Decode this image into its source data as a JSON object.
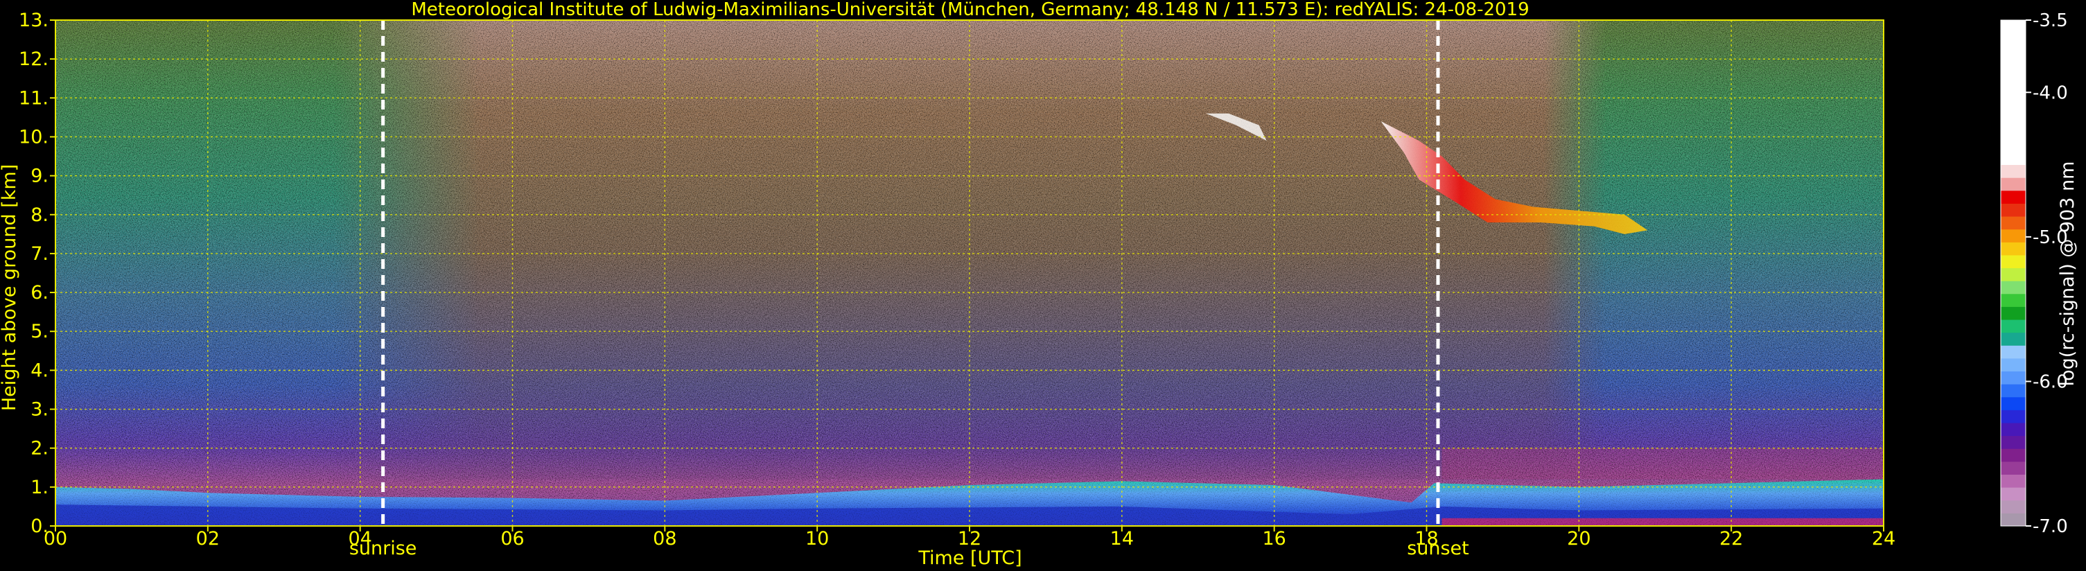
{
  "chart_data": {
    "type": "heatmap",
    "title": "Meteorological Institute of Ludwig-Maximilians-Universität (München, Germany; 48.148 N / 11.573 E):    redYALIS: 24-08-2019",
    "xlabel": "Time [UTC]",
    "ylabel": "Height above ground [km]",
    "xlim": [
      0,
      24
    ],
    "ylim": [
      0,
      13
    ],
    "x_ticks": [
      0,
      2,
      4,
      6,
      8,
      10,
      12,
      14,
      16,
      18,
      20,
      22,
      24
    ],
    "x_tick_labels": [
      "00",
      "02",
      "04",
      "06",
      "08",
      "10",
      "12",
      "14",
      "16",
      "18",
      "20",
      "22",
      "24"
    ],
    "y_ticks": [
      0,
      1,
      2,
      3,
      4,
      5,
      6,
      7,
      8,
      9,
      10,
      11,
      12,
      13
    ],
    "y_tick_labels": [
      "0.",
      "1.",
      "2.",
      "3.",
      "4.",
      "5.",
      "6.",
      "7.",
      "8.",
      "9.",
      "10.",
      "11.",
      "12.",
      "13."
    ],
    "grid": true,
    "events": [
      {
        "label": "sunrise",
        "time": 4.3
      },
      {
        "label": "sunset",
        "time": 18.15
      }
    ],
    "colorbar": {
      "label": "log(rc-signal) @ 903 nm",
      "range": [
        -7.0,
        -3.5
      ],
      "tick_values": [
        -3.5,
        -4.0,
        -5.0,
        -6.0,
        -7.0
      ],
      "tick_labels": [
        "-3.5",
        "-4.0",
        "-5.0",
        "-6.0",
        "-7.0"
      ],
      "colors": [
        "#a898ac",
        "#b898b8",
        "#c890c4",
        "#b868b0",
        "#983c98",
        "#80208c",
        "#6018a0",
        "#4818b8",
        "#2828d8",
        "#0c48f4",
        "#2c70f8",
        "#5898fc",
        "#78b4fc",
        "#98c8fc",
        "#18a890",
        "#1cc070",
        "#10a020",
        "#38c838",
        "#80e070",
        "#c0f040",
        "#f0f020",
        "#f8c810",
        "#f89808",
        "#f06010",
        "#e83010",
        "#e80000",
        "#f0a0a0",
        "#f8d8d8",
        "#ffffff"
      ]
    }
  }
}
